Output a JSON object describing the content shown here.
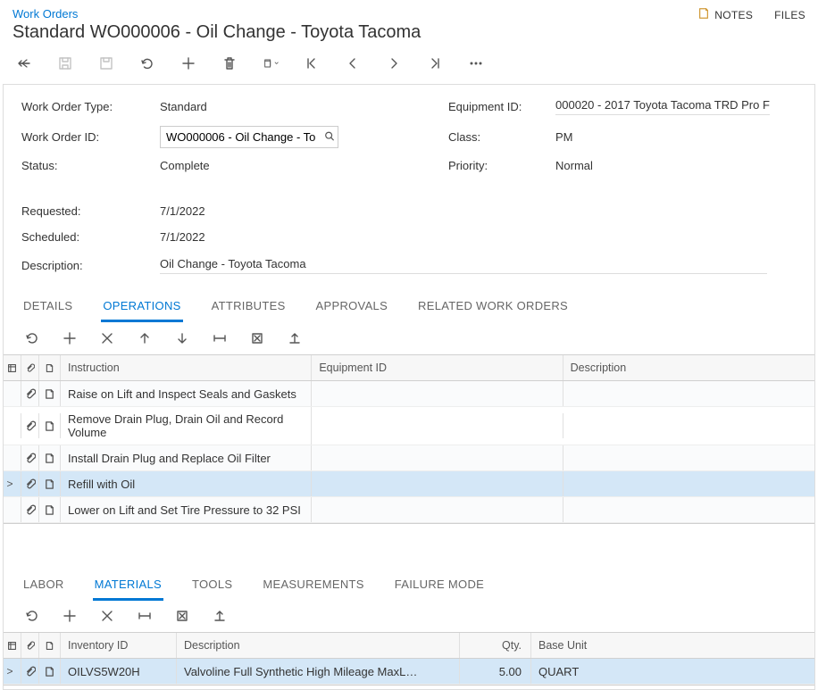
{
  "breadcrumb": "Work Orders",
  "page_title": "Standard WO000006 - Oil Change - Toyota Tacoma",
  "top_actions": {
    "notes": "NOTES",
    "files": "FILES"
  },
  "fields": {
    "work_order_type": {
      "label": "Work Order Type:",
      "value": "Standard"
    },
    "work_order_id": {
      "label": "Work Order ID:",
      "value": "WO000006 - Oil Change - To"
    },
    "status": {
      "label": "Status:",
      "value": "Complete"
    },
    "equipment_id": {
      "label": "Equipment ID:",
      "value": "000020 - 2017 Toyota Tacoma TRD Pro F"
    },
    "class": {
      "label": "Class:",
      "value": "PM"
    },
    "priority": {
      "label": "Priority:",
      "value": "Normal"
    },
    "requested": {
      "label": "Requested:",
      "value": "7/1/2022"
    },
    "scheduled": {
      "label": "Scheduled:",
      "value": "7/1/2022"
    },
    "description": {
      "label": "Description:",
      "value": "Oil Change - Toyota Tacoma"
    }
  },
  "tabs_main": {
    "details": "DETAILS",
    "operations": "OPERATIONS",
    "attributes": "ATTRIBUTES",
    "approvals": "APPROVALS",
    "related": "RELATED WORK ORDERS"
  },
  "ops_grid": {
    "headers": {
      "instruction": "Instruction",
      "equipment_id": "Equipment ID",
      "description": "Description"
    },
    "rows": [
      {
        "instruction": "Raise on Lift and Inspect Seals and Gaskets",
        "selected": false
      },
      {
        "instruction": "Remove Drain Plug, Drain Oil and Record Volume",
        "selected": false
      },
      {
        "instruction": "Install Drain Plug and Replace Oil Filter",
        "selected": false
      },
      {
        "instruction": "Refill with Oil",
        "selected": true
      },
      {
        "instruction": "Lower on Lift and Set Tire Pressure to 32 PSI",
        "selected": false
      }
    ]
  },
  "tabs_sub": {
    "labor": "LABOR",
    "materials": "MATERIALS",
    "tools": "TOOLS",
    "measurements": "MEASUREMENTS",
    "failure_mode": "FAILURE MODE"
  },
  "mat_grid": {
    "headers": {
      "inventory_id": "Inventory ID",
      "description": "Description",
      "qty": "Qty.",
      "base_unit": "Base Unit"
    },
    "rows": [
      {
        "inventory_id": "OILVS5W20H",
        "description": "Valvoline Full Synthetic High Mileage MaxL…",
        "qty": "5.00",
        "base_unit": "QUART",
        "selected": true
      }
    ]
  }
}
